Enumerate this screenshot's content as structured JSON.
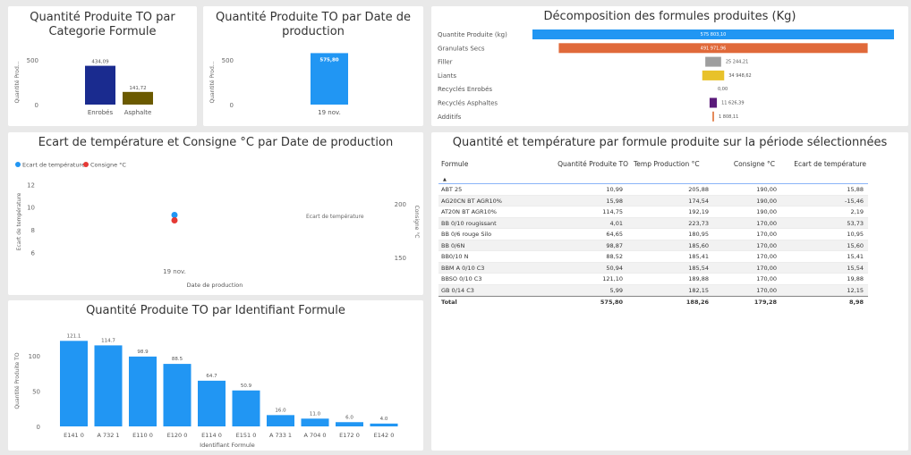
{
  "tile1": {
    "title": "Quantité Produite TO par Categorie Formule",
    "ylabel": "Quantité Prod...",
    "ticks": [
      "500",
      "0"
    ],
    "bars": [
      {
        "label": "Enrobés",
        "value": "434,09",
        "color": "#1a2b8f"
      },
      {
        "label": "Asphalte",
        "value": "141,72",
        "color": "#6b5a00"
      }
    ]
  },
  "tile2": {
    "title": "Quantité Produite TO par Date de production",
    "ylabel": "Quantité Prod...",
    "ticks": [
      "500",
      "0"
    ],
    "bar": {
      "label": "19 nov.",
      "value": "575,80",
      "color": "#2196f3"
    }
  },
  "tile3": {
    "title": "Décomposition des formules produites (Kg)",
    "rows": [
      {
        "label": "Quantite Produite (kg)",
        "value": "575 803,10",
        "color": "#2196f3"
      },
      {
        "label": "Granulats Secs",
        "value": "491 971,96",
        "color": "#e0693a"
      },
      {
        "label": "Filler",
        "value": "25 244,21",
        "color": "#9e9e9e"
      },
      {
        "label": "Liants",
        "value": "34 948,62",
        "color": "#e8c22a"
      },
      {
        "label": "Recyclés Enrobés",
        "value": "0,00",
        "color": "#999999"
      },
      {
        "label": "Recyclés Asphaltes",
        "value": "11 626,39",
        "color": "#5a1a7a"
      },
      {
        "label": "Additifs",
        "value": "1 808,11",
        "color": "#e58a5a"
      }
    ]
  },
  "tile4": {
    "title": "Ecart de température et Consigne °C par Date de production",
    "legend": [
      {
        "label": "Ecart de température",
        "color": "#2196f3"
      },
      {
        "label": "Consigne °C",
        "color": "#e53935"
      }
    ],
    "yleft_label": "Ecart de température",
    "yleft_ticks": [
      "12",
      "10",
      "8",
      "6"
    ],
    "yright_label": "Consigne °C",
    "yright_ticks": [
      "200",
      "150"
    ],
    "xlabel": "Date de production",
    "xtick": "19 nov.",
    "side_label": "Ecart de température"
  },
  "tile5": {
    "title": "Quantité Produite TO par Identifiant Formule",
    "ylabel": "Quantité Produite TO",
    "xlabel": "Identifiant Formule",
    "ticks": [
      "100",
      "50",
      "0"
    ],
    "color": "#2196f3"
  },
  "tile6": {
    "title": "Quantité et température par formule produite sur la période sélectionnées",
    "columns": [
      "Formule",
      "Quantité Produite TO",
      "Temp Production °C",
      "Consigne °C",
      "Ecart de température"
    ],
    "rows": [
      [
        "ABT 25",
        "10,99",
        "205,88",
        "190,00",
        "15,88"
      ],
      [
        "AG20CN BT AGR10%",
        "15,98",
        "174,54",
        "190,00",
        "-15,46"
      ],
      [
        "AT20N BT AGR10%",
        "114,75",
        "192,19",
        "190,00",
        "2,19"
      ],
      [
        "BB 0/10 rougissant",
        "4,01",
        "223,73",
        "170,00",
        "53,73"
      ],
      [
        "BB 0/6 rouge Silo",
        "64,65",
        "180,95",
        "170,00",
        "10,95"
      ],
      [
        "BB 0/6N",
        "98,87",
        "185,60",
        "170,00",
        "15,60"
      ],
      [
        "BB0/10 N",
        "88,52",
        "185,41",
        "170,00",
        "15,41"
      ],
      [
        "BBM A 0/10 C3",
        "50,94",
        "185,54",
        "170,00",
        "15,54"
      ],
      [
        "BBSO 0/10 C3",
        "121,10",
        "189,88",
        "170,00",
        "19,88"
      ],
      [
        "GB 0/14 C3",
        "5,99",
        "182,15",
        "170,00",
        "12,15"
      ]
    ],
    "total": [
      "Total",
      "575,80",
      "188,26",
      "179,28",
      "8,98"
    ]
  },
  "chart_data": [
    {
      "type": "bar",
      "title": "Quantité Produite TO par Categorie Formule",
      "categories": [
        "Enrobés",
        "Asphalte"
      ],
      "values": [
        434.09,
        141.72
      ],
      "ylabel": "Quantité Prod...",
      "ylim": [
        0,
        600
      ]
    },
    {
      "type": "bar",
      "title": "Quantité Produite TO par Date de production",
      "categories": [
        "19 nov."
      ],
      "values": [
        575.8
      ],
      "ylabel": "Quantité Prod...",
      "ylim": [
        0,
        600
      ]
    },
    {
      "type": "bar",
      "title": "Décomposition des formules produites (Kg)",
      "categories": [
        "Quantite Produite (kg)",
        "Granulats Secs",
        "Filler",
        "Liants",
        "Recyclés Enrobés",
        "Recyclés Asphaltes",
        "Additifs"
      ],
      "values": [
        575803.1,
        491971.96,
        25244.21,
        34948.62,
        0,
        11626.39,
        1808.11
      ]
    },
    {
      "type": "scatter",
      "title": "Ecart de température et Consigne °C par Date de production",
      "x": [
        "19 nov."
      ],
      "series": [
        {
          "name": "Ecart de température",
          "values": [
            9.3
          ]
        },
        {
          "name": "Consigne °C",
          "values": [
            179.28
          ]
        }
      ],
      "ylim": [
        5,
        12.5
      ],
      "y2lim": [
        140,
        205
      ]
    },
    {
      "type": "bar",
      "title": "Quantité Produite TO par Identifiant Formule",
      "categories": [
        "E141 0",
        "A 732 1",
        "E110 0",
        "E120 0",
        "E114 0",
        "E151 0",
        "A 733 1",
        "A 704 0",
        "E172 0",
        "E142 0"
      ],
      "values": [
        121.1,
        114.7,
        98.9,
        88.5,
        64.7,
        50.9,
        16.0,
        11.0,
        6.0,
        4.0
      ],
      "labels": [
        "121.1",
        "114.7",
        "98.9",
        "88.5",
        "64.7",
        "50.9",
        "16.0",
        "11.0",
        "6.0",
        "4.0"
      ],
      "xlabel": "Identifiant Formule",
      "ylabel": "Quantité Produite TO",
      "ylim": [
        0,
        130
      ]
    }
  ]
}
